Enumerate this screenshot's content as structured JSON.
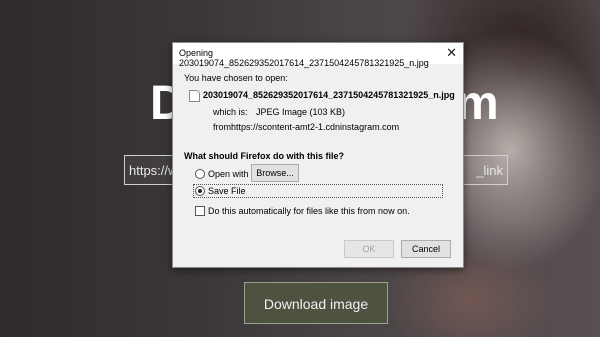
{
  "page": {
    "hero_title_left": "D",
    "hero_title_right": "m",
    "url_left": "https://w",
    "url_right": "_link",
    "download_button": "Download image"
  },
  "dialog": {
    "title": "Opening 203019074_852629352017614_2371504245781321925_n.jpg",
    "chosen_label": "You have chosen to open:",
    "filename": "203019074_852629352017614_2371504245781321925_n.jpg",
    "which_is_label": "which is:",
    "which_is_value": "JPEG Image (103 KB)",
    "from_label": "from:",
    "from_value": "https://scontent-amt2-1.cdninstagram.com",
    "question": "What should Firefox do with this file?",
    "open_with_label": "Open with",
    "browse_label": "Browse...",
    "save_file_label": "Save File",
    "save_file_selected": true,
    "auto_label": "Do this automatically for files like this from now on.",
    "ok_label": "OK",
    "cancel_label": "Cancel"
  }
}
